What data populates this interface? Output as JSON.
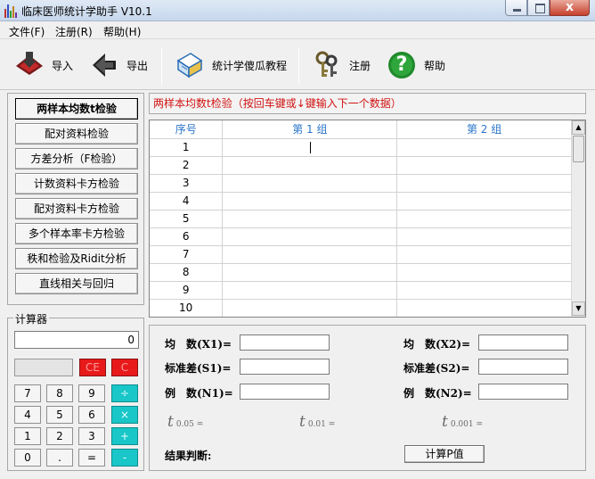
{
  "window": {
    "title": "临床医师统计学助手 V10.1",
    "close_glyph": "x"
  },
  "menu": [
    {
      "label": "文件(F)"
    },
    {
      "label": "注册(R)"
    },
    {
      "label": "帮助(H)"
    }
  ],
  "toolbar": {
    "import_label": "导入",
    "export_label": "导出",
    "tutorial_label": "统计学傻瓜教程",
    "register_label": "注册",
    "help_label": "帮助",
    "help_glyph": "?"
  },
  "nav": [
    {
      "label": "两样本均数t检验",
      "active": true
    },
    {
      "label": "配对资料检验"
    },
    {
      "label": "方差分析（F检验）"
    },
    {
      "label": "计数资料卡方检验"
    },
    {
      "label": "配对资料卡方检验"
    },
    {
      "label": "多个样本率卡方检验"
    },
    {
      "label": "秩和检验及Ridit分析"
    },
    {
      "label": "直线相关与回归"
    }
  ],
  "grid": {
    "caption": "两样本均数t检验（按回车键或↓键输入下一个数据）",
    "headers": [
      "序号",
      "第 1 组",
      "第 2 组"
    ],
    "rows": [
      "1",
      "2",
      "3",
      "4",
      "5",
      "6",
      "7",
      "8",
      "9",
      "10"
    ],
    "scroll_up": "▲",
    "scroll_down": "▼"
  },
  "calculator": {
    "title": "计算器",
    "display": "0",
    "keys": {
      "ce": "CE",
      "c": "C",
      "k7": "7",
      "k8": "8",
      "k9": "9",
      "div": "÷",
      "k4": "4",
      "k5": "5",
      "k6": "6",
      "mul": "×",
      "k1": "1",
      "k2": "2",
      "k3": "3",
      "add": "+",
      "k0": "0",
      "dot": ".",
      "eq": "=",
      "sub": "-"
    }
  },
  "stats": {
    "mean1": "均　数(X1)=",
    "mean2": "均　数(X2)=",
    "sd1": "标准差(S1)=",
    "sd2": "标准差(S2)=",
    "n1": "例　数(N1)=",
    "n2": "例　数(N2)=",
    "t1_sub": "0.05 =",
    "t2_sub": "0.01 =",
    "t3_sub": "0.001 =",
    "t_symbol": "t",
    "result_label": "结果判断:",
    "calc_button": "计算P值"
  },
  "colors": {
    "caption_red": "#d11212",
    "header_blue": "#2b75c9",
    "key_red": "#e8191a",
    "key_teal": "#19c6c8"
  }
}
